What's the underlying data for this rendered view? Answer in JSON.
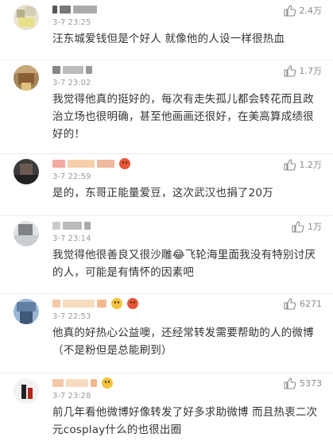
{
  "comments": [
    {
      "time": "3-7 23:25",
      "likes": "2.4万",
      "text": "汪东城爱钱但是个好人 就像他的人设一样很热血"
    },
    {
      "time": "3-7 23:02",
      "likes": "1.7万",
      "text": "我觉得他真的挺好的，每次有走失孤儿都会转花而且政治立场也很明确，甚至他画画还很好，在美高算成绩很好的！"
    },
    {
      "time": "3-7 22:59",
      "likes": "1.2万",
      "text": "是的，东哥正能量爱豆，这次武汉也捐了20万"
    },
    {
      "time": "3-7 23:14",
      "likes": "1万",
      "text": "我觉得他很善良又很沙雕😂飞轮海里面我没有特别讨厌的人，可能是有情怀的因素吧"
    },
    {
      "time": "3-7 22:53",
      "likes": "6271",
      "text": "他真的好热心公益噢，还经常转发需要帮助的人的微博（不是粉但是总能刷到）"
    },
    {
      "time": "3-7 23:28",
      "likes": "5373",
      "text": "前几年看他微博好像转发了好多求助微博 而且热衷二次元cosplay什么的也很出圈"
    }
  ],
  "colors": {
    "time": "#999999",
    "like": "#888888",
    "text": "#333333",
    "divider": "#ececec"
  }
}
